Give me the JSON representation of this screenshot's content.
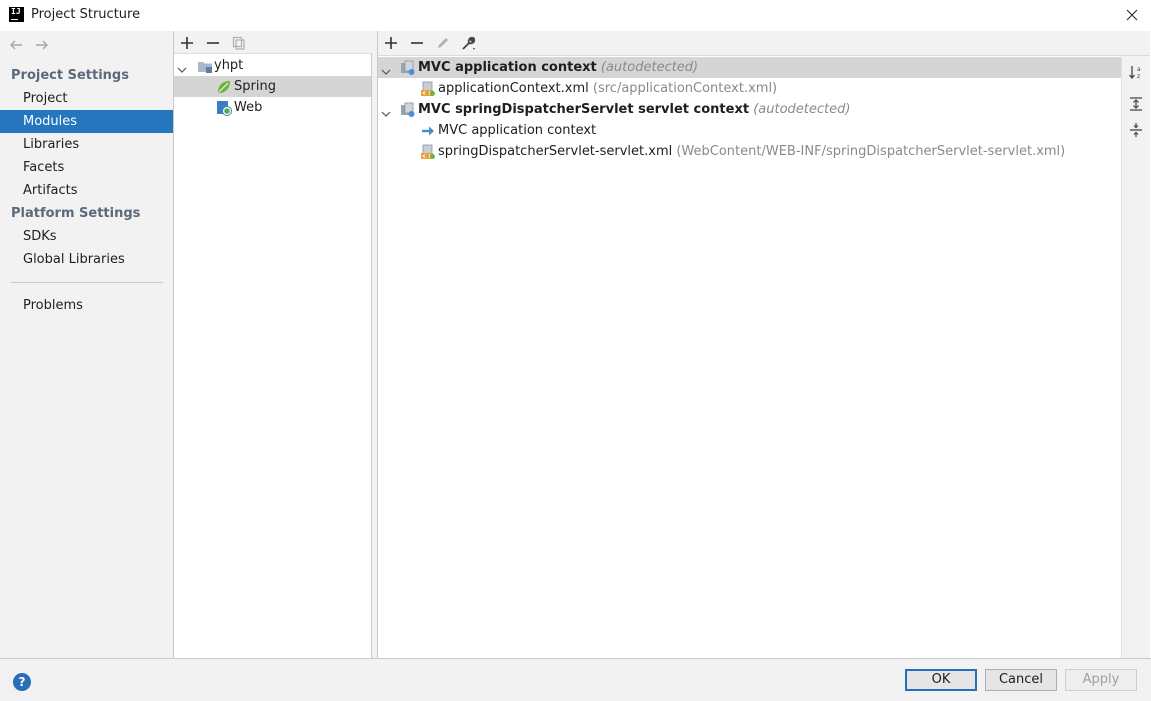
{
  "window": {
    "title": "Project Structure",
    "logo_text": "IJ"
  },
  "sidebar": {
    "project_settings_heading": "Project Settings",
    "project_items": [
      {
        "label": "Project",
        "selected": false
      },
      {
        "label": "Modules",
        "selected": true
      },
      {
        "label": "Libraries",
        "selected": false
      },
      {
        "label": "Facets",
        "selected": false
      },
      {
        "label": "Artifacts",
        "selected": false
      }
    ],
    "platform_settings_heading": "Platform Settings",
    "platform_items": [
      {
        "label": "SDKs"
      },
      {
        "label": "Global Libraries"
      }
    ],
    "problems_label": "Problems"
  },
  "modules_tree": {
    "root": {
      "label": "yhpt",
      "icon": "folder-module-icon"
    },
    "children": [
      {
        "label": "Spring",
        "icon": "spring-leaf-icon",
        "selected": true
      },
      {
        "label": "Web",
        "icon": "web-facet-icon",
        "selected": false
      }
    ]
  },
  "contexts": [
    {
      "name": "MVC application context",
      "note": "(autodetected)",
      "selected": true,
      "children": [
        {
          "label": "applicationContext.xml",
          "path": "(src/applicationContext.xml)",
          "icon": "spring-xml-icon"
        }
      ]
    },
    {
      "name": "MVC springDispatcherServlet servlet context",
      "note": "(autodetected)",
      "selected": false,
      "children": [
        {
          "label": "MVC application context",
          "path": "",
          "icon": "parent-context-arrow-icon"
        },
        {
          "label": "springDispatcherServlet-servlet.xml",
          "path": "(WebContent/WEB-INF/springDispatcherServlet-servlet.xml)",
          "icon": "spring-xml-icon"
        }
      ]
    }
  ],
  "footer": {
    "ok_label": "OK",
    "cancel_label": "Cancel",
    "apply_label": "Apply",
    "help_label": "?"
  },
  "colors": {
    "selection": "#2675bf",
    "row_selected": "#d5d5d5",
    "panel_bg": "#f2f2f2",
    "primary_border": "#2a6ebb"
  }
}
